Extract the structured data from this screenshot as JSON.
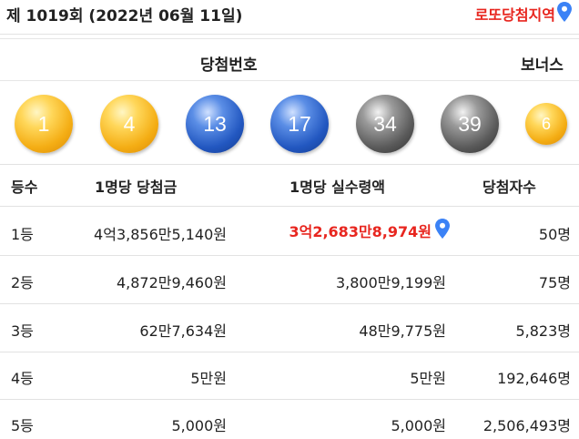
{
  "header": {
    "title": "제 1019회 (2022년 06월 11일)",
    "region_link": "로또당첨지역",
    "region_icon": "location-pin-icon"
  },
  "numbers": {
    "winning_label": "당첨번호",
    "bonus_label": "보너스",
    "winning": [
      "1",
      "4",
      "13",
      "17",
      "34",
      "39"
    ],
    "bonus": "6",
    "colors": {
      "yellow": "#f4ad14",
      "blue": "#2257c0",
      "gray": "#5a5a5a"
    }
  },
  "table": {
    "headers": [
      "등수",
      "1명당 당첨금",
      "1명당 실수령액",
      "당첨자수"
    ],
    "rows": [
      {
        "rank": "1등",
        "prize": "4억3,856만5,140원",
        "net": "3억2,683만8,974원",
        "winners": "50명"
      },
      {
        "rank": "2등",
        "prize": "4,872만9,460원",
        "net": "3,800만9,199원",
        "winners": "75명"
      },
      {
        "rank": "3등",
        "prize": "62만7,634원",
        "net": "48만9,775원",
        "winners": "5,823명"
      },
      {
        "rank": "4등",
        "prize": "5만원",
        "net": "5만원",
        "winners": "192,646명"
      },
      {
        "rank": "5등",
        "prize": "5,000원",
        "net": "5,000원",
        "winners": "2,506,493명"
      }
    ],
    "highlight_color": "#e8261f"
  }
}
